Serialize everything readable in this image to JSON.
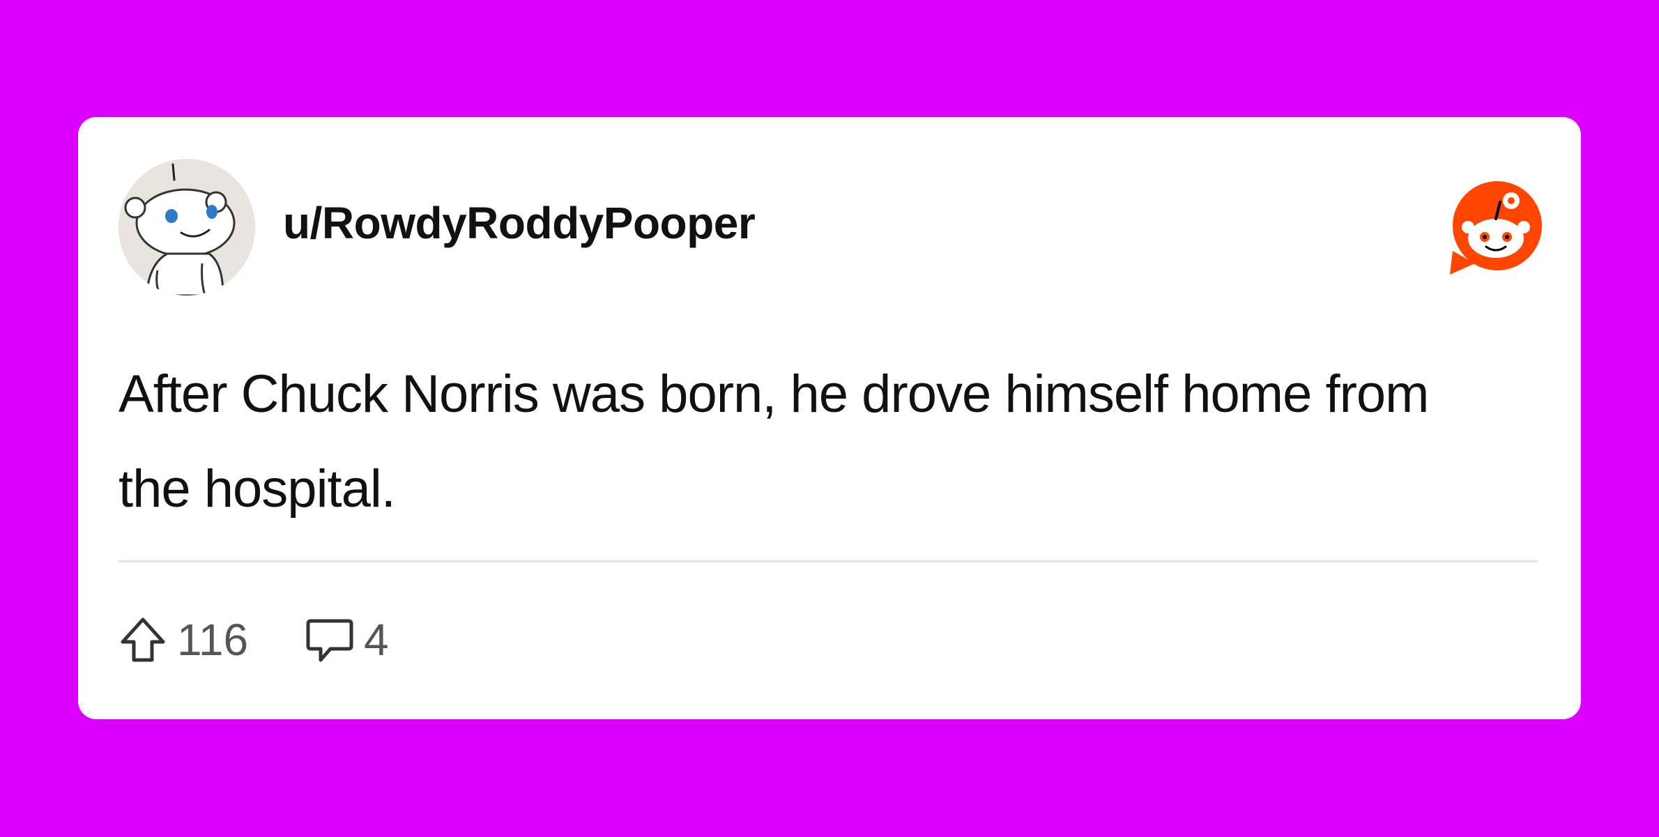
{
  "post": {
    "username": "u/RowdyRoddyPooper",
    "text": "After Chuck Norris was born, he drove himself home from the hospital.",
    "upvotes": "116",
    "comments": "4"
  },
  "icons": {
    "avatar": "reddit-snoo-avatar",
    "logo": "reddit-logo-icon",
    "upvote": "upvote-arrow-icon",
    "comment": "comment-bubble-icon"
  },
  "colors": {
    "background": "#DB00FF",
    "card": "#FFFFFF",
    "reddit_orange": "#FF4500",
    "text": "#111111",
    "meta_text": "#555555"
  }
}
